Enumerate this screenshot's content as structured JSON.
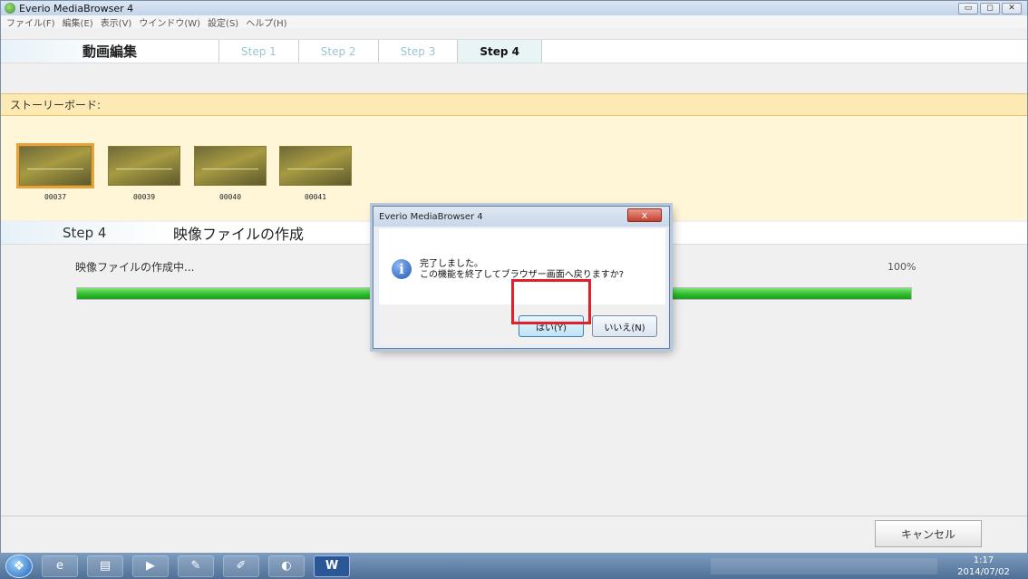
{
  "window": {
    "title": "Everio MediaBrowser 4",
    "controls": [
      "▭",
      "◻",
      "✕"
    ]
  },
  "menubar": {
    "items": [
      "ファイル(F)",
      "編集(E)",
      "表示(V)",
      "ウインドウ(W)",
      "設定(S)",
      "ヘルプ(H)"
    ]
  },
  "stepbar": {
    "brand": "動画編集",
    "steps": [
      {
        "label": "Step 1"
      },
      {
        "label": "Step 2"
      },
      {
        "label": "Step 3"
      },
      {
        "label": "Step 4",
        "active": true
      }
    ]
  },
  "storyboard": {
    "header": "ストーリーボード:",
    "clips": [
      {
        "label": "00037",
        "selected": true
      },
      {
        "label": "00039"
      },
      {
        "label": "00040"
      },
      {
        "label": "00041"
      }
    ]
  },
  "step4": {
    "label": "Step 4",
    "title": "映像ファイルの作成",
    "status": "映像ファイルの作成中...",
    "percent_text": "100%",
    "progress": 1.0,
    "progress_color": "#2fbf2b"
  },
  "footer": {
    "cancel_label": "キャンセル"
  },
  "dialog": {
    "title": "Everio MediaBrowser 4",
    "close": "x",
    "icon": "info-icon",
    "line1": "完了しました。",
    "line2": "この機能を終了してブラウザー画面へ戻りますか?",
    "yes_label": "はい(Y)",
    "no_label": "いいえ(N)",
    "highlight_color": "#e0202a"
  },
  "taskbar": {
    "start": "start-orb-icon",
    "apps": [
      {
        "icon": "ie-icon",
        "glyph": "e"
      },
      {
        "icon": "explorer-icon",
        "glyph": "▤"
      },
      {
        "icon": "media-player-icon",
        "glyph": "▶"
      },
      {
        "icon": "tool-icon",
        "glyph": "✎"
      },
      {
        "icon": "paint-icon",
        "glyph": "✐"
      },
      {
        "icon": "mediabrowser-icon",
        "glyph": "◐"
      },
      {
        "icon": "word-icon",
        "glyph": "W"
      }
    ],
    "clock_time": "1:17",
    "clock_date": "2014/07/02"
  }
}
